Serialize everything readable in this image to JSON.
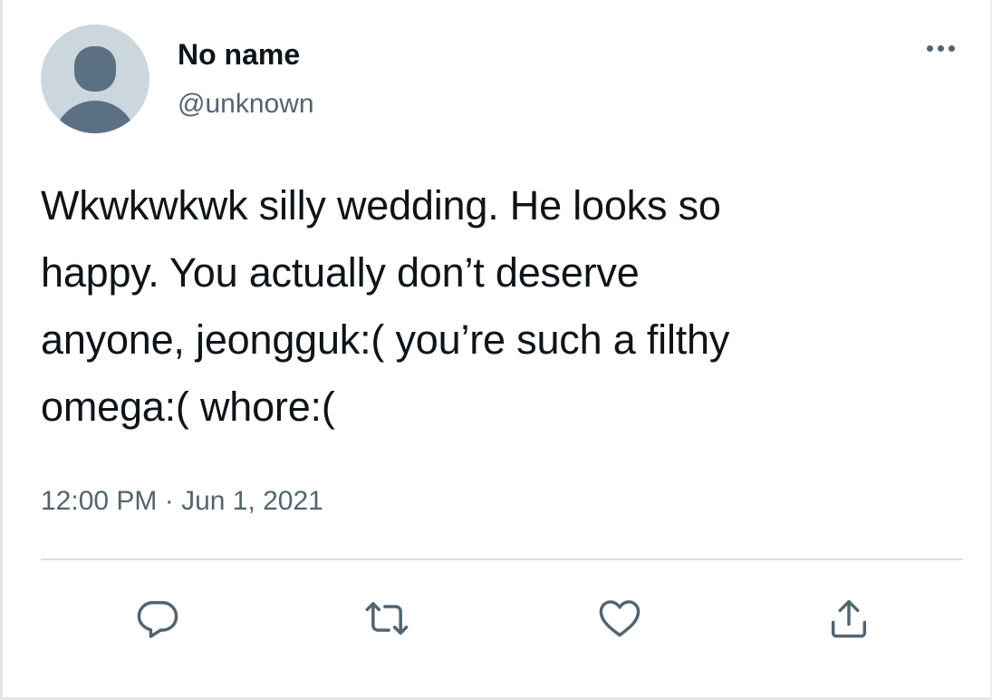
{
  "author": {
    "display_name": "No name",
    "handle": "@unknown"
  },
  "tweet": {
    "text": "Wkwkwkwk silly wedding. He looks so\nhappy. You actually don’t deserve\nanyone, jeongguk:( you’re such a filthy\nomega:( whore:(",
    "timestamp": "12:00 PM · Jun 1, 2021"
  },
  "icons": {
    "more": "more-horizontal-icon",
    "reply": "reply-icon",
    "retweet": "retweet-icon",
    "like": "heart-icon",
    "share": "share-icon"
  },
  "colors": {
    "text": "#0f1419",
    "secondary": "#536471",
    "avatar_bg": "#ccd6dd",
    "avatar_fg": "#5b7083",
    "divider": "#dcdfe2"
  }
}
